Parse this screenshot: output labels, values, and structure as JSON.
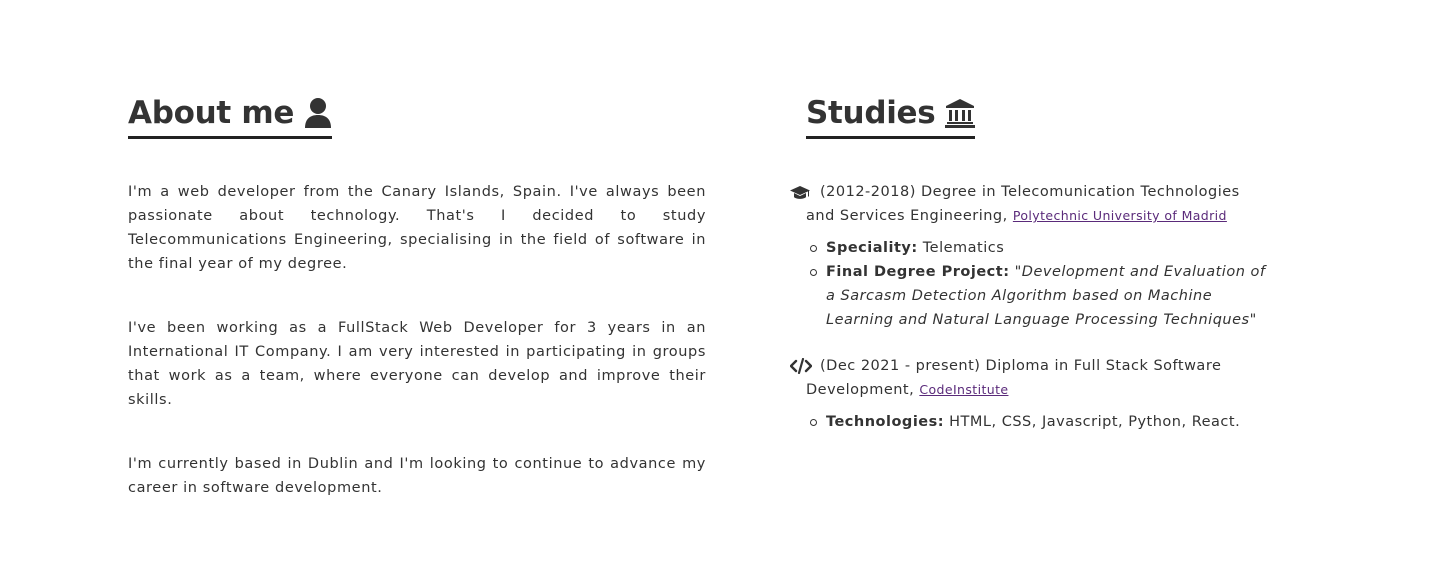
{
  "about": {
    "title": "About me",
    "title_icon": "user-icon",
    "paragraphs": [
      "I'm a web developer from the Canary Islands, Spain. I've always been passionate about technology. That's I decided to study Telecommunications Engineering, specialising in the field of software in the final year of my degree.",
      "I've been working as a FullStack Web Developer for 3 years in an International IT Company. I am very interested in participating in groups that work as a team, where everyone can develop and improve their skills.",
      "I'm currently based in Dublin and I'm looking to continue to advance my career in software development."
    ]
  },
  "studies": {
    "title": "Studies",
    "title_icon": "university-icon",
    "items": [
      {
        "icon": "graduation-cap-icon",
        "text": "(2012-2018) Degree in Telecomunication Technologies and Services Engineering,",
        "link": "Polytechnic University of Madrid",
        "details": [
          {
            "label": "Speciality:",
            "value": "Telematics"
          },
          {
            "label": "Final Degree Project:",
            "value": "\"Development and Evaluation of a Sarcasm Detection Algorithm based on Machine Learning and Natural Language Processing Techniques\""
          }
        ]
      },
      {
        "icon": "code-icon",
        "text": "(Dec 2021 - present) Diploma in Full Stack Software Development,",
        "link": "CodeInstitute",
        "details": [
          {
            "label": "Technologies:",
            "value": "HTML, CSS, Javascript, Python, React."
          }
        ]
      }
    ]
  },
  "colors": {
    "text": "#333333",
    "link": "#5a2a7a",
    "underline": "#222222"
  }
}
